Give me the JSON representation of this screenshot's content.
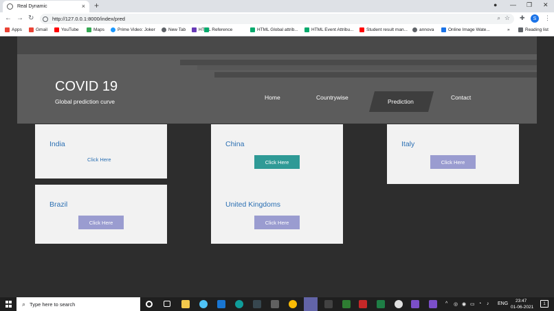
{
  "browser": {
    "tab_title": "Real Dynamic",
    "tab_close": "×",
    "new_tab": "+",
    "url": "http://127.0.0.1:8000/index/pred",
    "profile_initial": "S",
    "reading_list": "Reading list",
    "bookmarks": [
      {
        "label": "Apps",
        "icon_color": "#ea4335"
      },
      {
        "label": "Gmail",
        "icon_color": "#ea4335"
      },
      {
        "label": "YouTube",
        "icon_color": "#ff0000"
      },
      {
        "label": "Maps",
        "icon_color": "#34a853"
      },
      {
        "label": "Prime Video: Joker",
        "icon_color": "#1a98ff"
      },
      {
        "label": "New Tab",
        "icon_color": "#5f6368"
      },
      {
        "label": "HTML Reference",
        "icon_color": "#673ab7"
      },
      {
        "label": "HTML Global attrib...",
        "icon_color": "#04aa6d"
      },
      {
        "label": "HTML Event Attribu...",
        "icon_color": "#04aa6d"
      },
      {
        "label": "Student result man...",
        "icon_color": "#ff0000"
      },
      {
        "label": "annova",
        "icon_color": "#5f6368"
      },
      {
        "label": "Online Image Wate...",
        "icon_color": "#1a73e8"
      }
    ],
    "more_bookmarks": "»"
  },
  "site": {
    "title": "COVID 19",
    "subtitle": "Global prediction curve",
    "nav": {
      "home": "Home",
      "countrywise": "Countrywise",
      "prediction": "Prediction",
      "contact": "Contact"
    },
    "cards": {
      "india": {
        "name": "India",
        "link": "Click Here"
      },
      "brazil": {
        "name": "Brazil",
        "button": "Click Here"
      },
      "china": {
        "name": "China",
        "button": "Click Here"
      },
      "uk": {
        "name": "United Kingdoms",
        "button": "Click Here"
      },
      "italy": {
        "name": "Italy",
        "button": "Click Here"
      }
    },
    "colors": {
      "accent_teal": "#2f9a96",
      "button_lavender": "#9a9cd0",
      "card_title_blue": "#2a6fb3"
    }
  },
  "taskbar": {
    "search_placeholder": "Type here to search",
    "language": "ENG",
    "time": "23:47",
    "date": "01-06-2021",
    "notification_count": "1"
  }
}
